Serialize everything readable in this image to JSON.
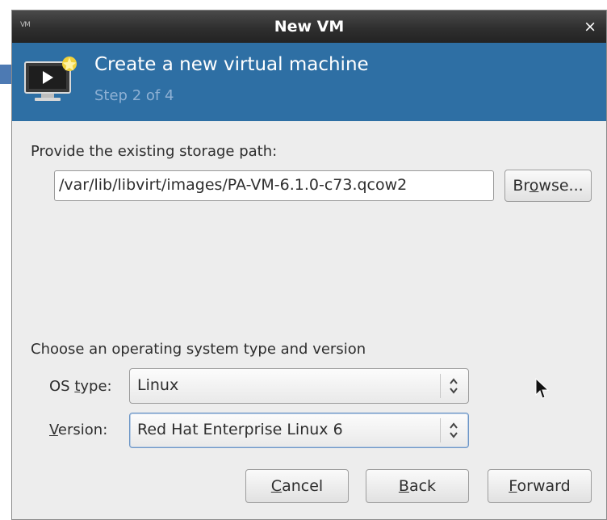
{
  "window": {
    "title": "New VM",
    "menu_icon": "VM",
    "close_label": "×"
  },
  "header": {
    "heading": "Create a new virtual machine",
    "step": "Step 2 of 4",
    "icon": "vm-monitor-icon"
  },
  "storage": {
    "prompt": "Provide the existing storage path:",
    "path_value": "/var/lib/libvirt/images/PA-VM-6.1.0-c73.qcow2",
    "browse_label": {
      "pre": "Br",
      "mnemonic": "o",
      "post": "wse..."
    }
  },
  "os": {
    "prompt": "Choose an operating system type and version",
    "type_label": {
      "pre": "OS ",
      "mnemonic": "t",
      "post": "ype:"
    },
    "type_value": "Linux",
    "version_label": {
      "pre": "",
      "mnemonic": "V",
      "post": "ersion:"
    },
    "version_value": "Red Hat Enterprise Linux 6"
  },
  "buttons": {
    "cancel": {
      "pre": "",
      "mnemonic": "C",
      "post": "ancel"
    },
    "back": {
      "pre": "",
      "mnemonic": "B",
      "post": "ack"
    },
    "forward": {
      "pre": "",
      "mnemonic": "F",
      "post": "orward"
    }
  },
  "colors": {
    "header_bg": "#2e6fa4",
    "titlebar_bg": "#2f2f2f",
    "dialog_bg": "#ededed"
  }
}
